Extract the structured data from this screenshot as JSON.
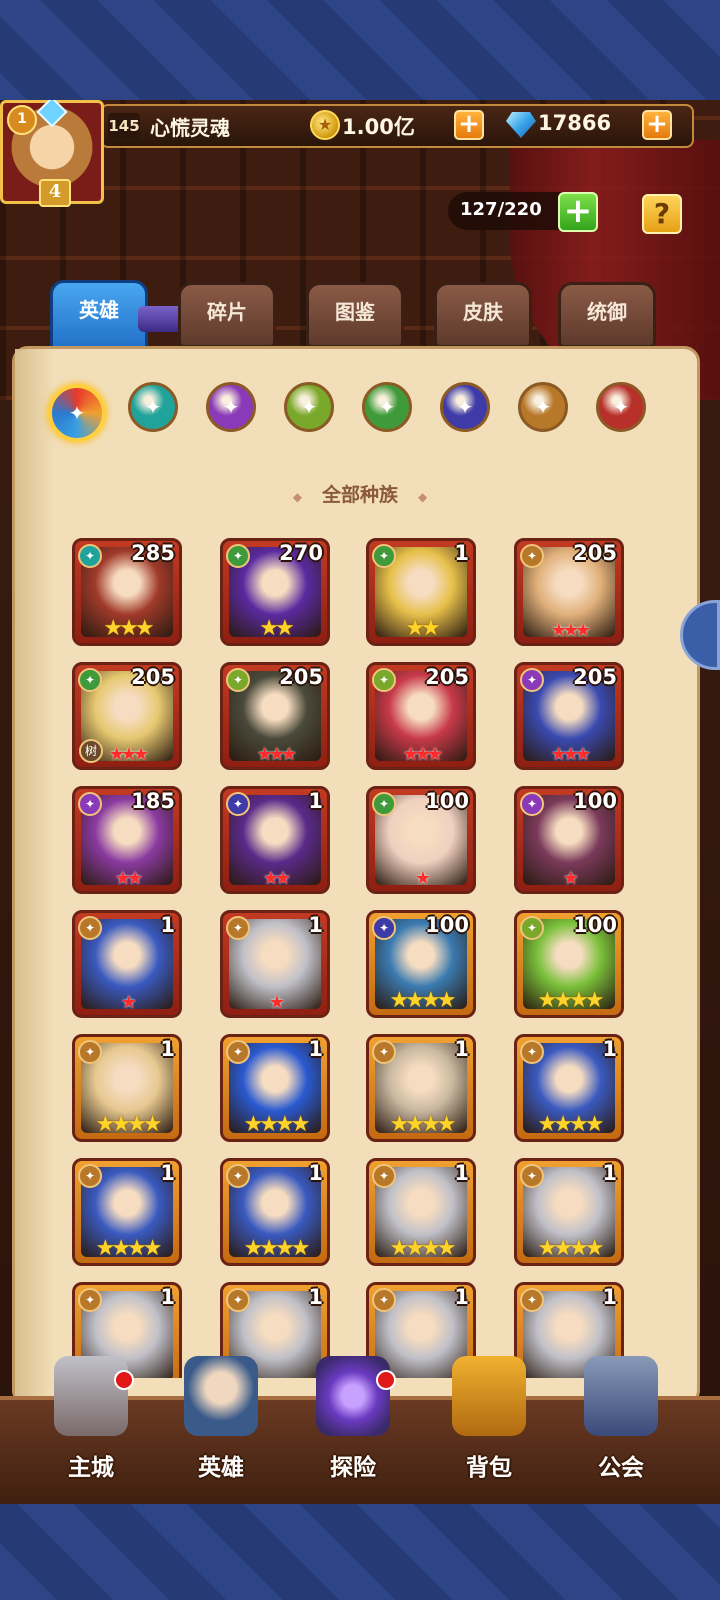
{
  "player": {
    "vip": "1",
    "rank": "4",
    "level": "145",
    "name": "心慌灵魂",
    "gold": "1.00亿",
    "diamonds": "17866"
  },
  "capacity": {
    "text": "127/220"
  },
  "help_label": "?",
  "tabs": [
    {
      "label": "英雄",
      "active": true
    },
    {
      "label": "碎片"
    },
    {
      "label": "图鉴"
    },
    {
      "label": "皮肤"
    },
    {
      "label": "统御"
    }
  ],
  "filters": [
    {
      "icon": "all-races-icon",
      "color": "#e8672a"
    },
    {
      "icon": "race-water-icon",
      "color": "#1fa39a"
    },
    {
      "icon": "race-void-icon",
      "color": "#8a3ab8"
    },
    {
      "icon": "race-nature-eye-icon",
      "color": "#7aa82a"
    },
    {
      "icon": "race-leaf-icon",
      "color": "#3e9a3a"
    },
    {
      "icon": "race-demon-icon",
      "color": "#3e3aa8"
    },
    {
      "icon": "race-light-icon",
      "color": "#b8782a"
    },
    {
      "icon": "race-fire-icon",
      "color": "#b8302a"
    }
  ],
  "section_title": "全部种族",
  "heroes": [
    {
      "level": "285",
      "stars": "★★★",
      "star_type": "gold",
      "frame": "red",
      "race": "race-water-icon",
      "race_color": "#1fa39a",
      "tone": "#a03a2a"
    },
    {
      "level": "270",
      "stars": "★★",
      "star_type": "gold",
      "frame": "red",
      "race": "race-leaf-icon",
      "race_color": "#3e9a3a",
      "tone": "#5a2aa0"
    },
    {
      "level": "1",
      "stars": "★★",
      "star_type": "gold",
      "frame": "red",
      "race": "race-leaf-icon",
      "race_color": "#3e9a3a",
      "tone": "#e6c04a"
    },
    {
      "level": "205",
      "stars": "★★★",
      "star_type": "red",
      "frame": "red",
      "race": "race-light-icon",
      "race_color": "#b8782a",
      "tone": "#e0b07a"
    },
    {
      "level": "205",
      "stars": "★★★",
      "star_type": "red",
      "frame": "red",
      "race": "race-leaf-icon",
      "race_color": "#3e9a3a",
      "tone": "#e6c870",
      "tag": "树"
    },
    {
      "level": "205",
      "stars": "★★★",
      "star_type": "red",
      "frame": "red",
      "race": "race-nature-eye-icon",
      "race_color": "#7aa82a",
      "tone": "#4a4a3a"
    },
    {
      "level": "205",
      "stars": "★★★",
      "star_type": "red",
      "frame": "red",
      "race": "race-nature-eye-icon",
      "race_color": "#7aa82a",
      "tone": "#c83a4a"
    },
    {
      "level": "205",
      "stars": "★★★",
      "star_type": "red",
      "frame": "red",
      "race": "race-void-icon",
      "race_color": "#8a3ab8",
      "tone": "#3a4ab0"
    },
    {
      "level": "185",
      "stars": "★★",
      "star_type": "red",
      "frame": "red",
      "race": "race-void-icon",
      "race_color": "#8a3ab8",
      "tone": "#8a3aa0"
    },
    {
      "level": "1",
      "stars": "★★",
      "star_type": "red",
      "frame": "red",
      "race": "race-demon-icon",
      "race_color": "#3e3aa8",
      "tone": "#5a2a8a"
    },
    {
      "level": "100",
      "stars": "★",
      "star_type": "red",
      "frame": "red",
      "race": "race-leaf-icon",
      "race_color": "#3e9a3a",
      "tone": "#f0d0c0"
    },
    {
      "level": "100",
      "stars": "★",
      "star_type": "red",
      "frame": "red",
      "race": "race-void-icon",
      "race_color": "#8a3ab8",
      "tone": "#7a3a5a"
    },
    {
      "level": "1",
      "stars": "★",
      "star_type": "red",
      "frame": "red",
      "race": "race-light-icon",
      "race_color": "#b8782a",
      "tone": "#3a5ac0"
    },
    {
      "level": "1",
      "stars": "★",
      "star_type": "red",
      "frame": "red",
      "race": "race-light-icon",
      "race_color": "#b8782a",
      "tone": "#c0c0c8"
    },
    {
      "level": "100",
      "stars": "★★★★",
      "star_type": "gold",
      "frame": "orange",
      "race": "race-demon-icon",
      "race_color": "#3e3aa8",
      "tone": "#3a7ab0"
    },
    {
      "level": "100",
      "stars": "★★★★",
      "star_type": "gold",
      "frame": "orange",
      "race": "race-nature-eye-icon",
      "race_color": "#7aa82a",
      "tone": "#7ac03a"
    },
    {
      "level": "1",
      "stars": "★★★★",
      "star_type": "gold",
      "frame": "orange",
      "race": "race-light-icon",
      "race_color": "#b8782a",
      "tone": "#e6c890"
    },
    {
      "level": "1",
      "stars": "★★★★",
      "star_type": "gold",
      "frame": "orange",
      "race": "race-light-icon",
      "race_color": "#b8782a",
      "tone": "#2a5ad0"
    },
    {
      "level": "1",
      "stars": "★★★★",
      "star_type": "gold",
      "frame": "orange",
      "race": "race-light-icon",
      "race_color": "#b8782a",
      "tone": "#c8b8a0"
    },
    {
      "level": "1",
      "stars": "★★★★",
      "star_type": "gold",
      "frame": "orange",
      "race": "race-light-icon",
      "race_color": "#b8782a",
      "tone": "#3a5ac0"
    },
    {
      "level": "1",
      "stars": "★★★★",
      "star_type": "gold",
      "frame": "orange",
      "race": "race-light-icon",
      "race_color": "#b8782a",
      "tone": "#3a5ac0"
    },
    {
      "level": "1",
      "stars": "★★★★",
      "star_type": "gold",
      "frame": "orange",
      "race": "race-light-icon",
      "race_color": "#b8782a",
      "tone": "#3a5ac0"
    },
    {
      "level": "1",
      "stars": "★★★★",
      "star_type": "gold",
      "frame": "orange",
      "race": "race-light-icon",
      "race_color": "#b8782a",
      "tone": "#c0c0c8"
    },
    {
      "level": "1",
      "stars": "★★★★",
      "star_type": "gold",
      "frame": "orange",
      "race": "race-light-icon",
      "race_color": "#b8782a",
      "tone": "#c0c0c8"
    },
    {
      "level": "1",
      "stars": "",
      "star_type": "gold",
      "frame": "orange",
      "race": "race-light-icon",
      "race_color": "#b8782a",
      "tone": "#c0c0c8"
    },
    {
      "level": "1",
      "stars": "",
      "star_type": "gold",
      "frame": "orange",
      "race": "race-light-icon",
      "race_color": "#b8782a",
      "tone": "#c0c0c8"
    },
    {
      "level": "1",
      "stars": "",
      "star_type": "gold",
      "frame": "orange",
      "race": "race-light-icon",
      "race_color": "#b8782a",
      "tone": "#c0c0c8"
    },
    {
      "level": "1",
      "stars": "",
      "star_type": "gold",
      "frame": "orange",
      "race": "race-light-icon",
      "race_color": "#b8782a",
      "tone": "#c0c0c8"
    }
  ],
  "nav": [
    {
      "label": "主城",
      "icon": "castle-icon",
      "dot": true
    },
    {
      "label": "英雄",
      "icon": "hero-icon",
      "dot": false
    },
    {
      "label": "探险",
      "icon": "portal-icon",
      "dot": true
    },
    {
      "label": "背包",
      "icon": "backpack-icon",
      "dot": false
    },
    {
      "label": "公会",
      "icon": "guild-icon",
      "dot": false
    }
  ]
}
